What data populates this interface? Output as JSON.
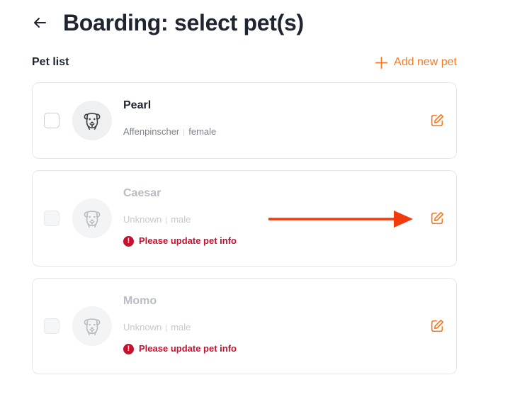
{
  "header": {
    "title": "Boarding: select pet(s)",
    "back_icon": "arrow-left-icon"
  },
  "pet_list": {
    "label": "Pet list",
    "add_label": "Add new pet",
    "add_icon": "plus-icon",
    "pets": [
      {
        "name": "Pearl",
        "breed": "Affenpinscher",
        "sex": "female",
        "enabled": true,
        "warning": ""
      },
      {
        "name": "Caesar",
        "breed": "Unknown",
        "sex": "male",
        "enabled": false,
        "warning": "Please update pet info"
      },
      {
        "name": "Momo",
        "breed": "Unknown",
        "sex": "male",
        "enabled": false,
        "warning": "Please update pet info"
      }
    ]
  },
  "icons": {
    "avatar": "dog-face-icon",
    "edit": "edit-pencil-icon",
    "warning": "exclamation-circle-icon",
    "annotation": "red-arrow-icon"
  },
  "colors": {
    "accent": "#f47b25",
    "warning": "#c8102e",
    "annotation": "#f23a0e",
    "title": "#1e2430"
  }
}
